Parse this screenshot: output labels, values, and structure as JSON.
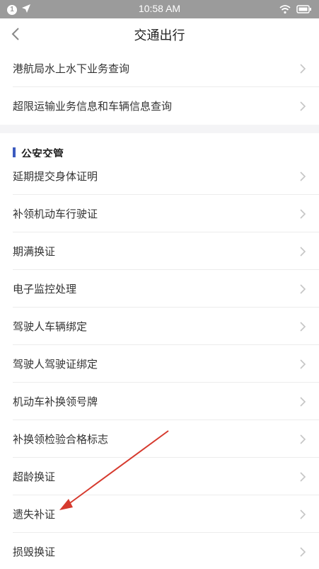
{
  "status_bar": {
    "notif_badge": "1",
    "time": "10:58 AM"
  },
  "nav": {
    "title": "交通出行"
  },
  "top_items": [
    {
      "label": "港航局水上水下业务查询"
    },
    {
      "label": "超限运输业务信息和车辆信息查询"
    }
  ],
  "section": {
    "title": "公安交管",
    "accent_color": "#3c5bbf",
    "items": [
      {
        "label": "延期提交身体证明"
      },
      {
        "label": "补领机动车行驶证"
      },
      {
        "label": "期满换证"
      },
      {
        "label": "电子监控处理"
      },
      {
        "label": "驾驶人车辆绑定"
      },
      {
        "label": "驾驶人驾驶证绑定"
      },
      {
        "label": "机动车补换领号牌"
      },
      {
        "label": "补换领检验合格标志"
      },
      {
        "label": "超龄换证"
      },
      {
        "label": "遗失补证"
      },
      {
        "label": "损毁换证"
      }
    ]
  },
  "annotation": {
    "arrow_color": "#d63a2e"
  }
}
